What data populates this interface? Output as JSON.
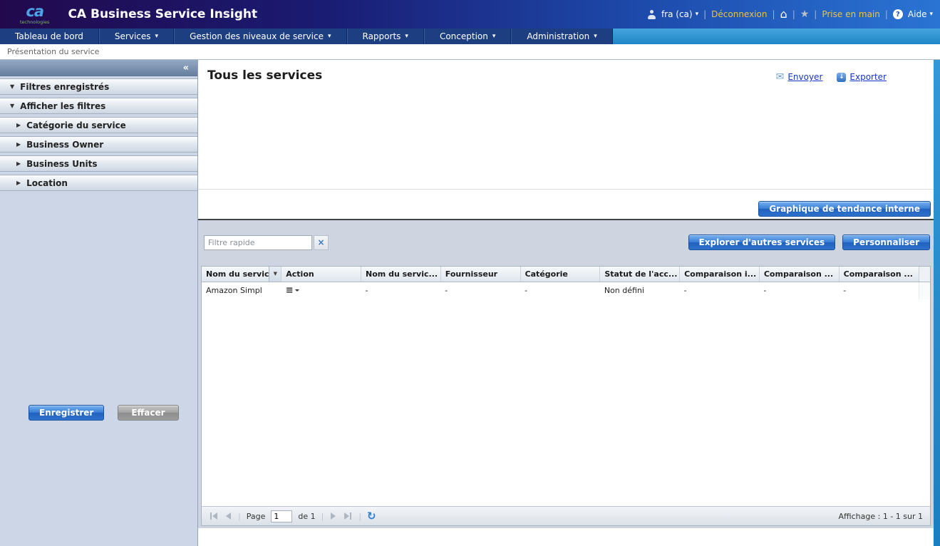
{
  "colors": {
    "header_purple": "#22094d",
    "header_blue": "#2a74d4",
    "nav_blue": "#1d3f82",
    "accent_cyan": "#1f86c6",
    "link_yellow": "#f0c33c",
    "link_blue": "#1733cc",
    "sidebar_bg": "#cdd6e7",
    "panel_bg": "#ced5e0",
    "button_blue": "#2e73cc"
  },
  "icons": {
    "collapse": "«",
    "home": "⌂",
    "star": "★",
    "help": "?",
    "mail": "✉",
    "export_arrow": "↓",
    "refresh": "↻",
    "action_menu": "≡",
    "caret_down": "▾",
    "expanded": "▼",
    "collapsed": "▶",
    "clear": "×",
    "sort": "▼"
  },
  "header": {
    "logo_main": "ca",
    "logo_sub": "technologies",
    "title": "CA Business Service Insight",
    "user_label": "fra (ca)",
    "logout_label": "Déconnexion",
    "getting_started_label": "Prise en main",
    "help_label": "Aide"
  },
  "nav": {
    "items": [
      {
        "label": "Tableau de bord",
        "caret": false
      },
      {
        "label": "Services",
        "caret": true
      },
      {
        "label": "Gestion des niveaux de service",
        "caret": true
      },
      {
        "label": "Rapports",
        "caret": true
      },
      {
        "label": "Conception",
        "caret": true
      },
      {
        "label": "Administration",
        "caret": true
      }
    ]
  },
  "breadcrumb": {
    "text": "Présentation du service"
  },
  "sidebar": {
    "sections": [
      {
        "label": "Filtres enregistrés",
        "expanded": true,
        "level": 1
      },
      {
        "label": "Afficher les filtres",
        "expanded": true,
        "level": 1
      },
      {
        "label": "Catégorie du service",
        "expanded": false,
        "level": 2
      },
      {
        "label": "Business Owner",
        "expanded": false,
        "level": 2
      },
      {
        "label": "Business Units",
        "expanded": false,
        "level": 2
      },
      {
        "label": "Location",
        "expanded": false,
        "level": 2
      }
    ],
    "save_label": "Enregistrer",
    "clear_label": "Effacer"
  },
  "content": {
    "page_title": "Tous les services",
    "send_label": "Envoyer",
    "export_label": "Exporter",
    "trend_button_label": "Graphique de tendance interne",
    "quick_filter_placeholder": "Filtre rapide",
    "explore_button_label": "Explorer d'autres services",
    "customize_button_label": "Personnaliser"
  },
  "table": {
    "columns": [
      "Nom du servic",
      "Action",
      "Nom du servic...",
      "Fournisseur",
      "Catégorie",
      "Statut de l'acc...",
      "Comparaison i...",
      "Comparaison ...",
      "Comparaison ..."
    ],
    "rows": [
      [
        "Amazon Simpl",
        "",
        "-",
        "-",
        "-",
        "Non défini",
        "-",
        "-",
        "-"
      ]
    ]
  },
  "pager": {
    "page_label": "Page",
    "current_page": "1",
    "of_label": "de 1",
    "display_label": "Affichage : 1 - 1 sur 1"
  }
}
